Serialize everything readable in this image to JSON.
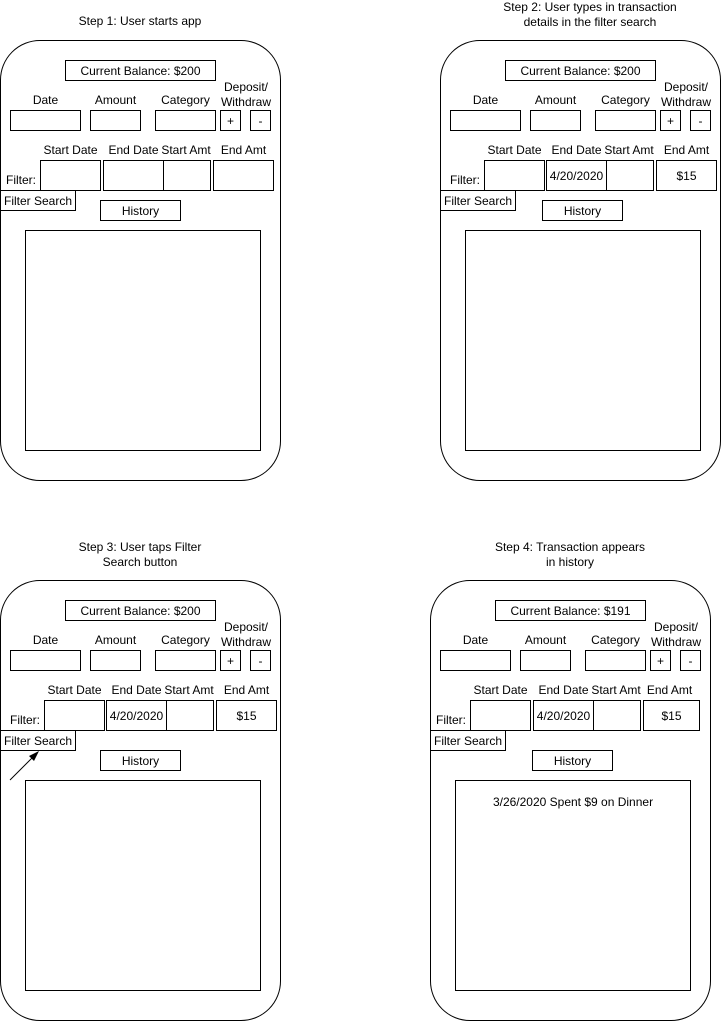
{
  "steps": [
    {
      "caption": "Step 1: User starts app",
      "balance": "Current Balance: $200",
      "labels": {
        "date": "Date",
        "amount": "Amount",
        "category": "Category",
        "deposit_withdraw": "Deposit/\nWithdraw"
      },
      "buttons": {
        "plus": "+",
        "minus": "-",
        "filter_search": "Filter Search",
        "history": "History"
      },
      "filter": {
        "label": "Filter:",
        "headers": {
          "start_date": "Start Date",
          "end_date": "End Date",
          "start_amt": "Start Amt",
          "end_amt": "End Amt"
        },
        "values": {
          "start_date": "",
          "end_date": "",
          "start_amt": "",
          "end_amt": ""
        }
      },
      "history_entries": []
    },
    {
      "caption": "Step 2: User types in transaction\ndetails in the filter search",
      "balance": "Current Balance: $200",
      "labels": {
        "date": "Date",
        "amount": "Amount",
        "category": "Category",
        "deposit_withdraw": "Deposit/\nWithdraw"
      },
      "buttons": {
        "plus": "+",
        "minus": "-",
        "filter_search": "Filter Search",
        "history": "History"
      },
      "filter": {
        "label": "Filter:",
        "headers": {
          "start_date": "Start Date",
          "end_date": "End Date",
          "start_amt": "Start Amt",
          "end_amt": "End Amt"
        },
        "values": {
          "start_date": "",
          "end_date": "4/20/2020",
          "start_amt": "",
          "end_amt": "$15"
        }
      },
      "history_entries": []
    },
    {
      "caption": "Step 3: User taps Filter\nSearch button",
      "balance": "Current Balance: $200",
      "labels": {
        "date": "Date",
        "amount": "Amount",
        "category": "Category",
        "deposit_withdraw": "Deposit/\nWithdraw"
      },
      "buttons": {
        "plus": "+",
        "minus": "-",
        "filter_search": "Filter Search",
        "history": "History"
      },
      "filter": {
        "label": "Filter:",
        "headers": {
          "start_date": "Start Date",
          "end_date": "End Date",
          "start_amt": "Start Amt",
          "end_amt": "End Amt"
        },
        "values": {
          "start_date": "",
          "end_date": "4/20/2020",
          "start_amt": "",
          "end_amt": "$15"
        }
      },
      "history_entries": []
    },
    {
      "caption": "Step 4: Transaction appears\nin history",
      "balance": "Current Balance: $191",
      "labels": {
        "date": "Date",
        "amount": "Amount",
        "category": "Category",
        "deposit_withdraw": "Deposit/\nWithdraw"
      },
      "buttons": {
        "plus": "+",
        "minus": "-",
        "filter_search": "Filter Search",
        "history": "History"
      },
      "filter": {
        "label": "Filter:",
        "headers": {
          "start_date": "Start Date",
          "end_date": "End Date",
          "start_amt": "Start Amt",
          "end_amt": "End Amt"
        },
        "values": {
          "start_date": "",
          "end_date": "4/20/2020",
          "start_amt": "",
          "end_amt": "$15"
        }
      },
      "history_entries": [
        "3/26/2020 Spent $9 on Dinner"
      ]
    }
  ]
}
